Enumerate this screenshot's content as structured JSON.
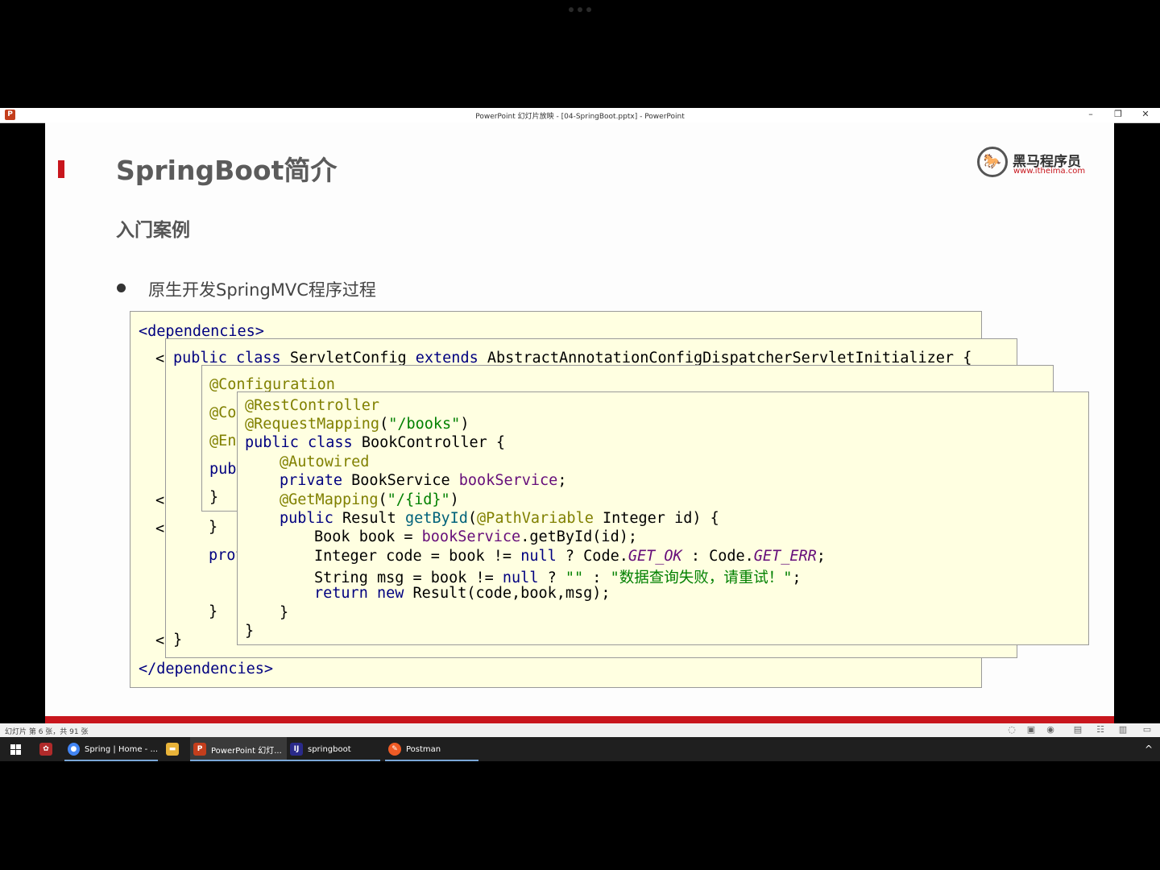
{
  "window": {
    "title": "PowerPoint 幻灯片放映 - [04-SpringBoot.pptx] - PowerPoint",
    "minimize": "–",
    "restore": "❐",
    "close": "✕",
    "app_icon": "P"
  },
  "slide": {
    "title": "SpringBoot简介",
    "subtitle": "入门案例",
    "bullet": "原生开发SpringMVC程序过程",
    "accent_color": "#c8161d",
    "logo": {
      "icon": "horse-logo-icon",
      "mark": "🐎",
      "name": "黑马程序员",
      "url": "www.itheima.com"
    }
  },
  "code": {
    "pom": {
      "open": "<dependencies>",
      "close": "</dependencies>",
      "fragments": [
        "<",
        "<",
        "<",
        "<"
      ]
    },
    "servlet_config": {
      "line1_kw1": "public",
      "line1_kw2": "class",
      "line1_name": "ServletConfig",
      "line1_kw3": "extends",
      "line1_parent": "AbstractAnnotationConfigDispatcherServletInitializer",
      "line1_brace": "{",
      "frag_brace": "}",
      "frag_prot": "prot",
      "frag_brace2": "}",
      "close": "}"
    },
    "spring_config": {
      "ann1": "@Configuration",
      "frag_co": "@Co",
      "frag_en": "@En",
      "frag_pub": "pub",
      "close": "}"
    },
    "controller": {
      "l1": "@RestController",
      "l2_ann": "@RequestMapping",
      "l2_open": "(",
      "l2_str": "\"/books\"",
      "l2_close": ")",
      "l3_kw1": "public",
      "l3_kw2": "class",
      "l3_name": "BookController {",
      "l4": "@Autowired",
      "l5_kw": "private",
      "l5_type": "BookService",
      "l5_field": "bookService",
      "l5_end": ";",
      "l6_ann": "@GetMapping",
      "l6_open": "(",
      "l6_str": "\"/{id}\"",
      "l6_close": ")",
      "l7_kw": "public",
      "l7_type": "Result",
      "l7_method": "getById",
      "l7_open": "(",
      "l7_ann": "@PathVariable",
      "l7_rest": "Integer id) {",
      "l8_a": "Book book = ",
      "l8_field": "bookService",
      "l8_b": ".getById(id);",
      "l9_a": "Integer code = book != ",
      "l9_null": "null",
      "l9_b": " ? Code.",
      "l9_ok": "GET_OK",
      "l9_c": " : Code.",
      "l9_err": "GET_ERR",
      "l9_d": ";",
      "l10_a": "String msg = book != ",
      "l10_null": "null",
      "l10_b": " ? ",
      "l10_s1": "\"\"",
      "l10_c": " : ",
      "l10_s2": "\"数据查询失败，请重试！\"",
      "l10_d": ";",
      "l11_kw1": "return",
      "l11_kw2": "new",
      "l11_rest": "Result(code,book,msg);",
      "l12": "}",
      "l13": "}"
    }
  },
  "statusbar": {
    "left": "幻灯片 第 6 张，共 91 张",
    "controls": [
      "◌",
      "▣",
      "◉",
      "▤",
      "☷",
      "▥",
      "▭"
    ]
  },
  "taskbar": {
    "start_icon": "windows-icon",
    "items": [
      {
        "label": "Spring | Home - ...",
        "icon": "chrome-icon",
        "glyph": "●",
        "color": "#4285f4"
      },
      {
        "label": "",
        "icon": "folder-icon",
        "glyph": "▬",
        "color": "#e8b339"
      },
      {
        "label": "PowerPoint 幻灯...",
        "icon": "powerpoint-icon",
        "glyph": "P",
        "color": "#c43e1c"
      },
      {
        "label": "springboot",
        "icon": "intellij-icon",
        "glyph": "IJ",
        "color": "#2a2a8a"
      },
      {
        "label": "Postman",
        "icon": "postman-icon",
        "glyph": "✎",
        "color": "#ef5b25"
      }
    ],
    "tray": "^"
  }
}
